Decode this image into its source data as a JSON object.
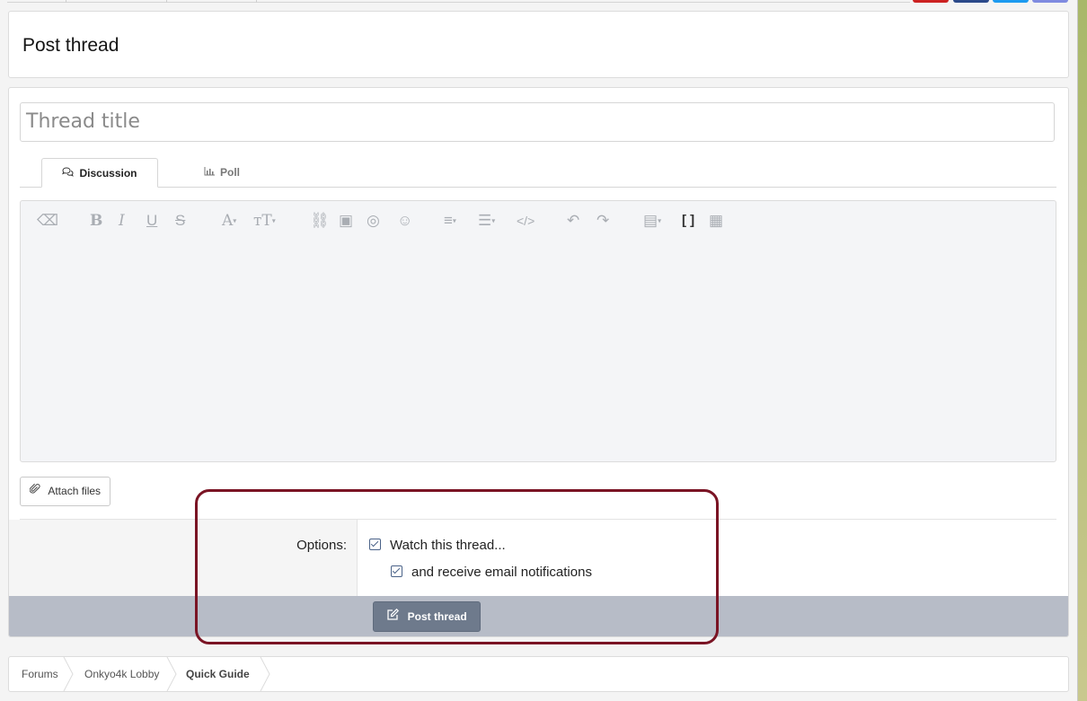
{
  "page": {
    "title": "Post thread"
  },
  "form": {
    "title_placeholder": "Thread title",
    "tabs": [
      {
        "label": "Discussion",
        "icon": "comments-icon",
        "active": true
      },
      {
        "label": "Poll",
        "icon": "bar-chart-icon",
        "active": false
      }
    ],
    "toolbar": [
      "eraser-icon",
      "bold-icon",
      "italic-icon",
      "underline-icon",
      "strikethrough-icon",
      "font-color-icon",
      "font-size-icon",
      "link-icon",
      "image-icon",
      "spoiler-hidden-icon",
      "smiley-icon",
      "align-icon",
      "list-icon",
      "code-icon",
      "undo-icon",
      "redo-icon",
      "draft-save-icon",
      "bbcode-toggle-icon",
      "media-gallery-icon"
    ],
    "attach_label": "Attach files",
    "options_label": "Options:",
    "watch_label": "Watch this thread...",
    "email_label": "and receive email notifications",
    "watch_checked": true,
    "email_checked": true,
    "submit_label": "Post thread"
  },
  "breadcrumbs": [
    "Forums",
    "Onkyo4k Lobby",
    "Quick Guide"
  ]
}
